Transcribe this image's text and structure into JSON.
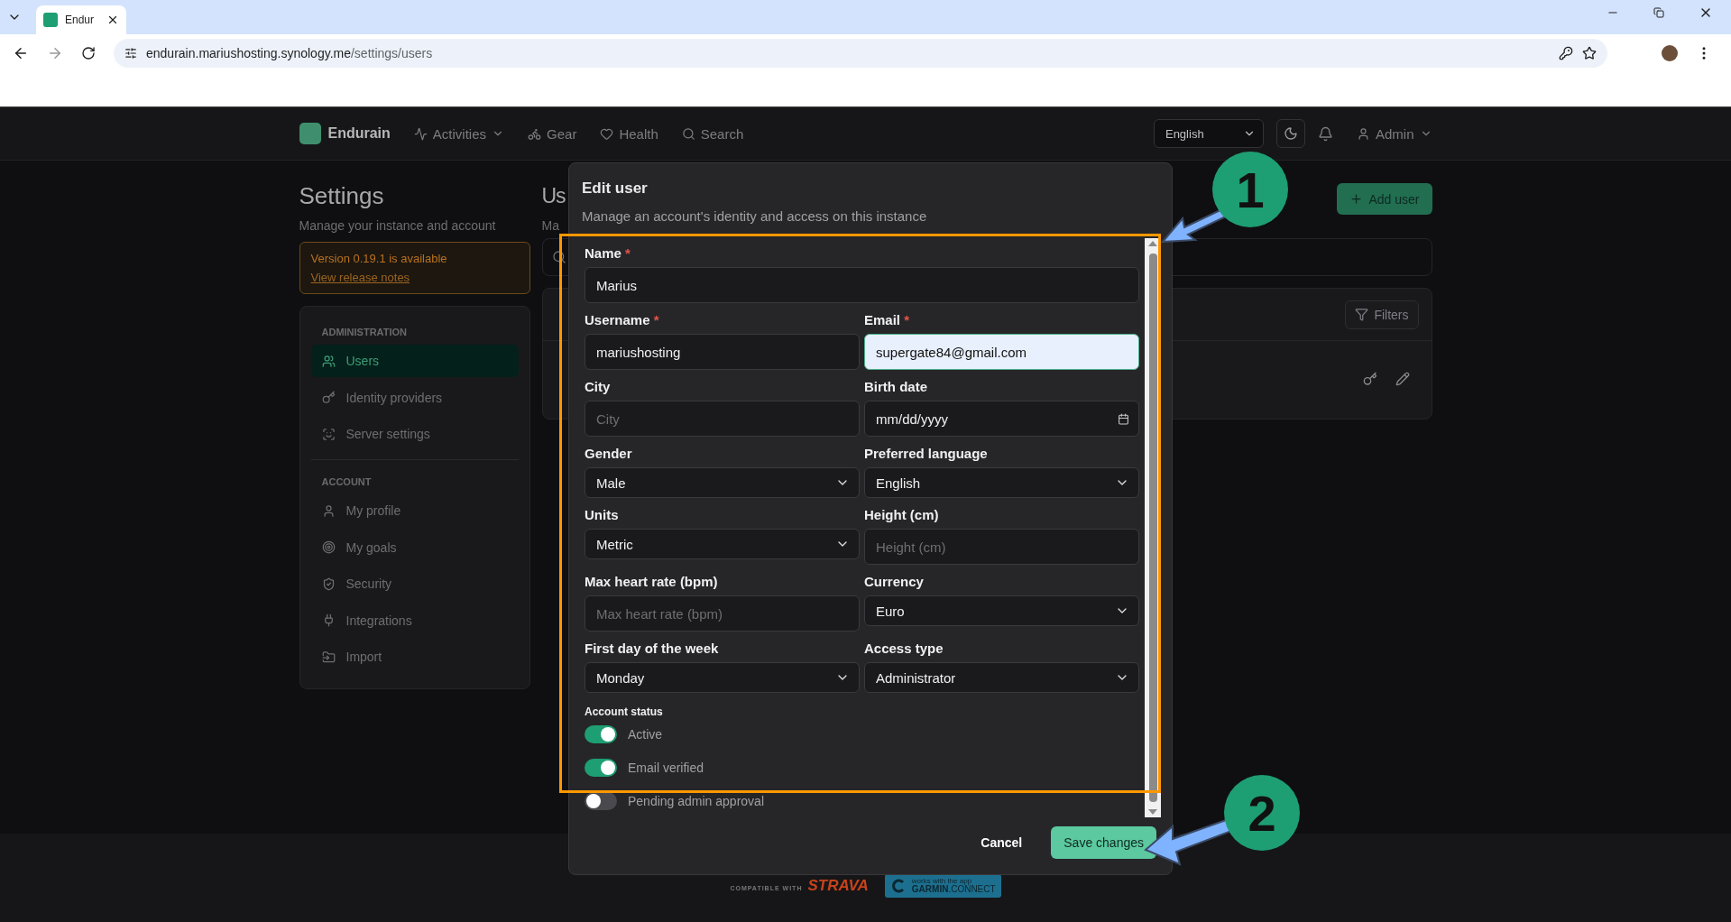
{
  "browser": {
    "tab_title": "Endur",
    "url_host": "endurain.mariushosting.synology.me",
    "url_path": "/settings/users"
  },
  "nav": {
    "brand": "Endurain",
    "items": [
      {
        "label": "Activities",
        "dropdown": true
      },
      {
        "label": "Gear",
        "dropdown": false
      },
      {
        "label": "Health",
        "dropdown": false
      },
      {
        "label": "Search",
        "dropdown": false
      }
    ],
    "language": "English",
    "user": "Admin"
  },
  "settings": {
    "title": "Settings",
    "subtitle": "Manage your instance and account",
    "alert": {
      "text": "Version 0.19.1 is available",
      "link": "View release notes"
    },
    "sections": [
      {
        "heading": "ADMINISTRATION",
        "items": [
          {
            "label": "Users",
            "selected": true
          },
          {
            "label": "Identity providers",
            "selected": false
          },
          {
            "label": "Server settings",
            "selected": false
          }
        ]
      },
      {
        "heading": "ACCOUNT",
        "items": [
          {
            "label": "My profile",
            "selected": false
          },
          {
            "label": "My goals",
            "selected": false
          },
          {
            "label": "Security",
            "selected": false
          },
          {
            "label": "Integrations",
            "selected": false
          },
          {
            "label": "Import",
            "selected": false
          }
        ]
      }
    ]
  },
  "main": {
    "title": "Us",
    "subtitle": "Ma",
    "add_button": "Add user",
    "filters_button": "Filters"
  },
  "modal": {
    "title": "Edit user",
    "subtitle": "Manage an account's identity and access on this instance",
    "rows": [
      {
        "fields": [
          {
            "label": "Name",
            "required_mark": "*",
            "kind": "text",
            "value": "Marius",
            "focused": false
          }
        ]
      },
      {
        "fields": [
          {
            "label": "Username",
            "required_mark": "*",
            "kind": "text",
            "value": "mariushosting",
            "focused": false
          },
          {
            "label": "Email",
            "required_mark": "*",
            "kind": "text",
            "value": "supergate84@gmail.com",
            "focused": true
          }
        ]
      },
      {
        "fields": [
          {
            "label": "City",
            "kind": "text",
            "placeholder": "City",
            "focused": false
          },
          {
            "label": "Birth date",
            "kind": "date",
            "value": "mm/dd/yyyy",
            "focused": false
          }
        ]
      },
      {
        "fields": [
          {
            "label": "Gender",
            "kind": "select",
            "value": "Male",
            "focused": false
          },
          {
            "label": "Preferred language",
            "kind": "select",
            "value": "English",
            "focused": false
          }
        ]
      },
      {
        "fields": [
          {
            "label": "Units",
            "kind": "select",
            "value": "Metric",
            "focused": false
          },
          {
            "label": "Height (cm)",
            "kind": "text",
            "placeholder": "Height (cm)",
            "focused": false
          }
        ]
      },
      {
        "fields": [
          {
            "label": "Max heart rate (bpm)",
            "kind": "text",
            "placeholder": "Max heart rate (bpm)",
            "focused": false
          },
          {
            "label": "Currency",
            "kind": "select",
            "value": "Euro",
            "focused": false
          }
        ]
      },
      {
        "fields": [
          {
            "label": "First day of the week",
            "kind": "select",
            "value": "Monday",
            "focused": false
          },
          {
            "label": "Access type",
            "kind": "select",
            "value": "Administrator",
            "focused": false
          }
        ]
      }
    ],
    "status_heading": "Account status",
    "toggles": [
      {
        "label": "Active",
        "on": true
      },
      {
        "label": "Email verified",
        "on": true
      },
      {
        "label": "Pending admin approval",
        "on": false
      }
    ],
    "cancel": "Cancel",
    "save": "Save changes"
  },
  "footer": {
    "strava_prefix": "COMPATIBLE WITH",
    "strava": "STRAVA",
    "garmin_small": "works with the app",
    "garmin": "GARMIN",
    "garmin_suffix": ".CONNECT"
  },
  "annotations": [
    {
      "number": "1"
    },
    {
      "number": "2"
    }
  ]
}
